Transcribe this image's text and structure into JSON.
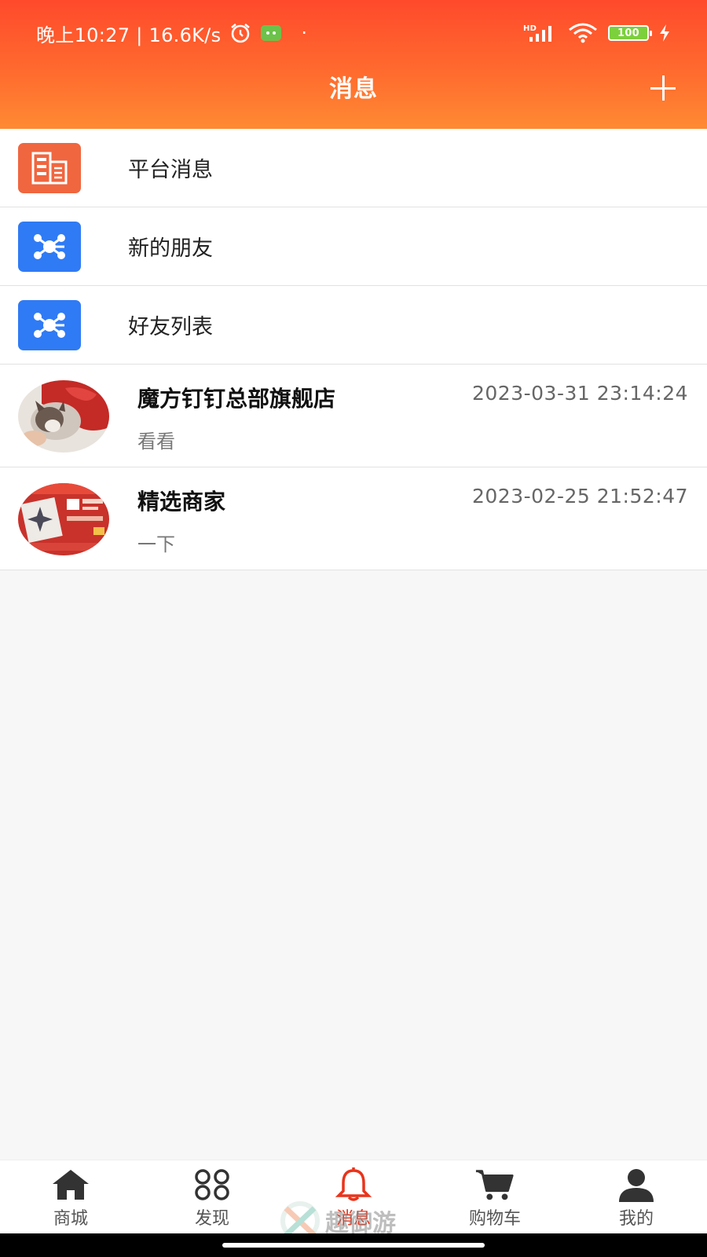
{
  "status_bar": {
    "time_speed": "晚上10:27 | 16.6K/s",
    "network": "HD",
    "battery": "100"
  },
  "nav": {
    "title": "消息"
  },
  "menu": [
    {
      "label": "平台消息",
      "icon": "document-icon",
      "color": "#f0663f"
    },
    {
      "label": "新的朋友",
      "icon": "network-icon",
      "color": "#2f7bf5"
    },
    {
      "label": "好友列表",
      "icon": "network-icon",
      "color": "#2f7bf5"
    }
  ],
  "chats": [
    {
      "name": "魔方钉钉总部旗舰店",
      "time": "2023-03-31 23:14:24",
      "preview": "看看",
      "avatar": "cat-photo-avatar"
    },
    {
      "name": "精选商家",
      "time": "2023-02-25 21:52:47",
      "preview": "一下",
      "avatar": "product-promo-avatar"
    }
  ],
  "tabs": [
    {
      "label": "商城",
      "icon": "home-icon"
    },
    {
      "label": "发现",
      "icon": "discover-icon"
    },
    {
      "label": "消息",
      "icon": "bell-icon",
      "active": true
    },
    {
      "label": "购物车",
      "icon": "cart-icon"
    },
    {
      "label": "我的",
      "icon": "user-icon"
    }
  ],
  "watermark": "趣御游",
  "colors": {
    "header_top": "#ff4a2c",
    "header_bottom": "#ff8a33",
    "active_tab": "#e8341c",
    "platform_icon_bg": "#f0663f",
    "friend_icon_bg": "#2f7bf5"
  }
}
